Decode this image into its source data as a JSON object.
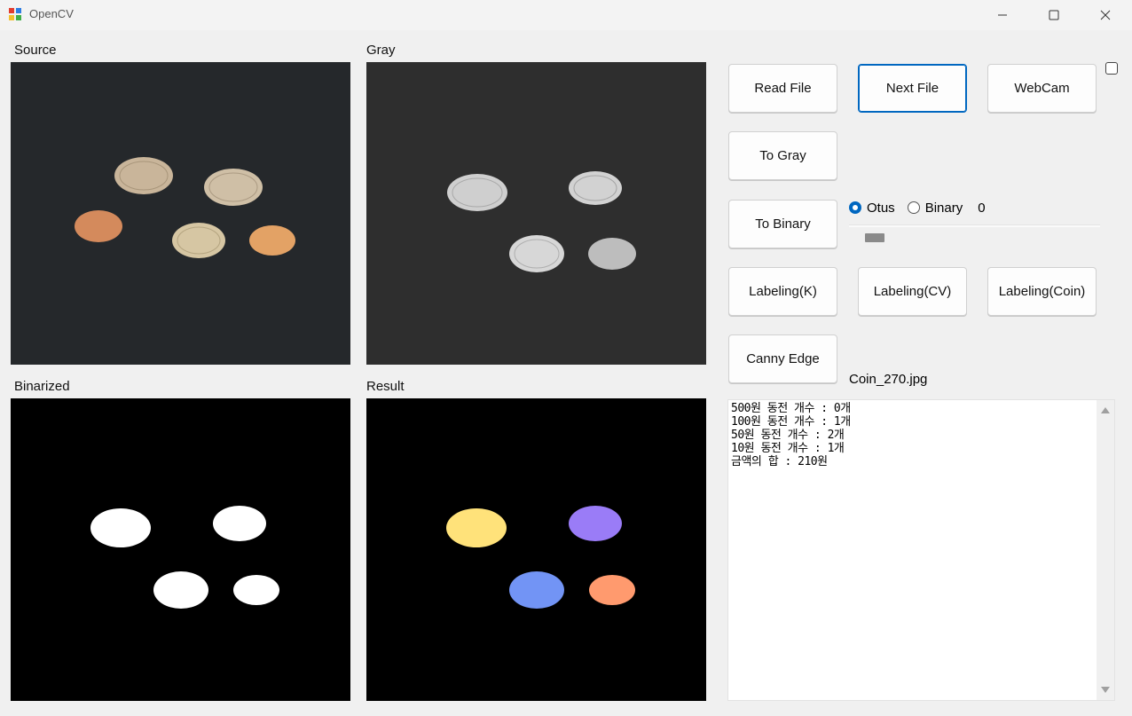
{
  "window": {
    "title": "OpenCV"
  },
  "panels": {
    "source": {
      "label": "Source"
    },
    "gray": {
      "label": "Gray"
    },
    "binarized": {
      "label": "Binarized"
    },
    "result": {
      "label": "Result"
    }
  },
  "buttons": {
    "read_file": "Read File",
    "next_file": "Next File",
    "webcam": "WebCam",
    "to_gray": "To Gray",
    "to_binary": "To Binary",
    "labeling_k": "Labeling(K)",
    "labeling_cv": "Labeling(CV)",
    "labeling_coin": "Labeling(Coin)",
    "canny_edge": "Canny Edge"
  },
  "threshold": {
    "option_otus": "Otus",
    "option_binary": "Binary",
    "selected": "Otus",
    "value": "0"
  },
  "file_name": "Coin_270.jpg",
  "output_text": "500원 동전 개수 : 0개\n100원 동전 개수 : 1개\n50원 동전 개수 : 2개\n10원 동전 개수 : 1개\n금액의 합 : 210원",
  "colors": {
    "accent": "#0067c0",
    "label_yellow": "#ffe27a",
    "label_purple": "#9a7cf7",
    "label_blue": "#7294f5",
    "label_orange": "#ff9a6e"
  },
  "icons": {
    "app": "opencv-app-icon",
    "minimize": "minimize-icon",
    "maximize": "maximize-icon",
    "close": "close-icon"
  }
}
